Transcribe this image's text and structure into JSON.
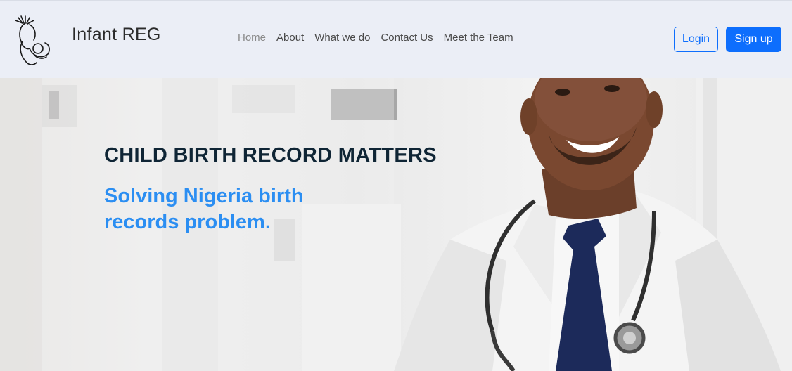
{
  "header": {
    "brand": "Infant REG",
    "nav": [
      {
        "label": "Home"
      },
      {
        "label": "About"
      },
      {
        "label": "What we do"
      },
      {
        "label": "Contact Us"
      },
      {
        "label": "Meet the Team"
      }
    ],
    "login_label": "Login",
    "signup_label": "Sign up"
  },
  "hero": {
    "title": "CHILD BIRTH RECORD MATTERS",
    "subtitle": "Solving Nigeria birth records problem."
  },
  "colors": {
    "primary": "#0d6efd",
    "subtitle": "#2b8ef2",
    "title": "#0f2535",
    "navbar_bg": "#ebeef6"
  },
  "icons": {
    "logo": "mother-and-child-logo"
  }
}
